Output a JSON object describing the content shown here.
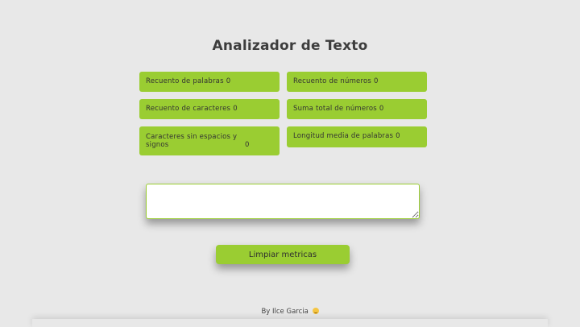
{
  "header": {
    "title": "Analizador de Texto"
  },
  "metrics": [
    {
      "label": "Recuento de palabras",
      "value": "0"
    },
    {
      "label": "Recuento de números",
      "value": "0"
    },
    {
      "label": "Recuento de caracteres",
      "value": "0"
    },
    {
      "label": "Suma total de números",
      "value": "0"
    },
    {
      "label": "Caracteres sin espacios y signos",
      "value": "0"
    },
    {
      "label": "Longitud media de palabras",
      "value": "0"
    }
  ],
  "editor": {
    "value": "",
    "placeholder": ""
  },
  "actions": {
    "clear_label": "Limpiar metricas"
  },
  "footer": {
    "credit": "By Ilce Garcia",
    "emoji": "winking-face-with-tongue-icon"
  },
  "colors": {
    "accent": "#9acd32",
    "background": "#e8e8e8",
    "text": "#3a3a3a"
  }
}
